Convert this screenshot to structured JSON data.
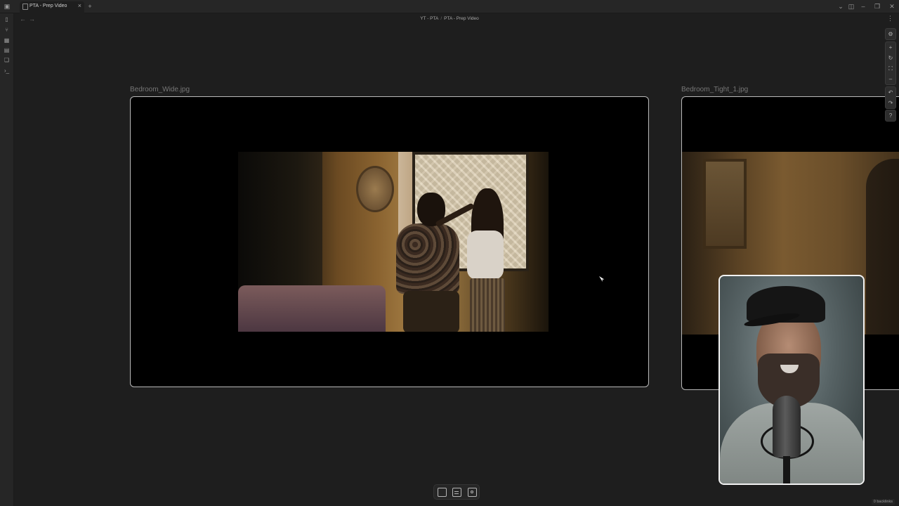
{
  "tabbar": {
    "tab_title": "PTA - Prep Video",
    "close_glyph": "×",
    "new_tab_glyph": "+"
  },
  "header": {
    "breadcrumb": [
      "YT - PTA",
      "PTA - Prep Video"
    ],
    "breadcrumb_separator": "/"
  },
  "canvas": {
    "nodes": [
      {
        "label": "Bedroom_Wide.jpg"
      },
      {
        "label": "Bedroom_Tight_1.jpg"
      }
    ]
  },
  "controls": {
    "icons": [
      "settings-icon",
      "zoom-in-icon",
      "reset-zoom-icon",
      "zoom-to-fit-icon",
      "zoom-out-icon",
      "undo-icon",
      "redo-icon",
      "help-icon"
    ]
  },
  "bottom_toolbar": {
    "icons": [
      "new-card-icon",
      "add-note-icon",
      "add-media-icon"
    ]
  },
  "status": {
    "backlinks": "0 backlinks"
  },
  "colors": {
    "background": "#1e1e1e",
    "chrome": "#262626",
    "node_border": "#b9b9b9",
    "webcam_border": "#f2f2f2"
  }
}
